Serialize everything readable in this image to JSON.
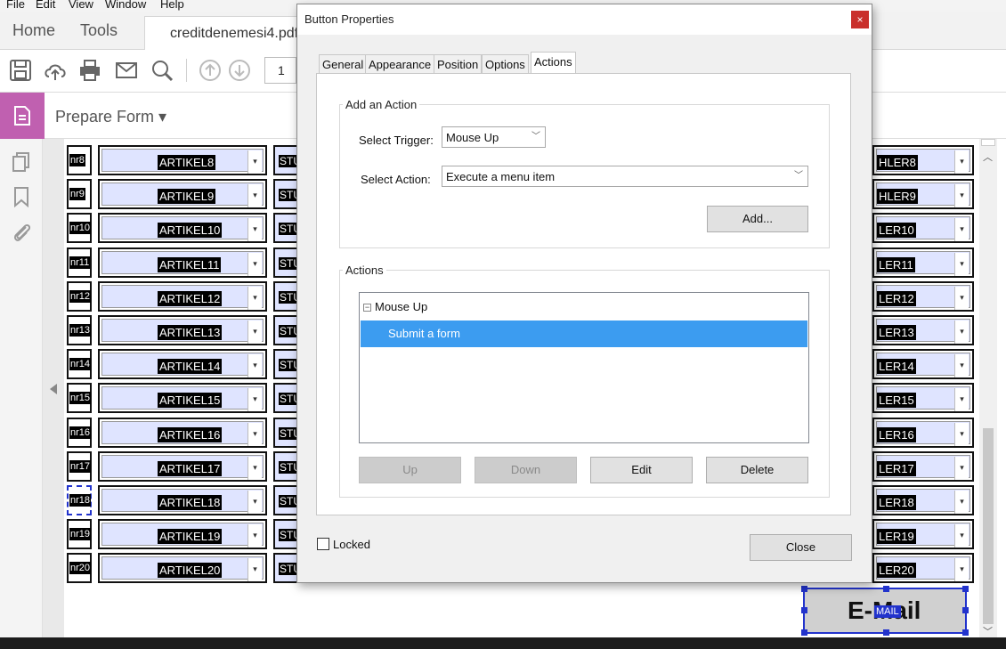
{
  "menu": {
    "file": "File",
    "edit": "Edit",
    "view": "View",
    "window": "Window",
    "help": "Help"
  },
  "tabs": {
    "home": "Home",
    "tools": "Tools",
    "document": "creditdenemesi4.pdf"
  },
  "toolbar": {
    "page_number": "1"
  },
  "prepare_form": {
    "label": "Prepare Form ▾"
  },
  "rows": [
    {
      "nr": "nr8",
      "artikel": "ARTIKEL8",
      "stu": "STU",
      "right": "HLER8"
    },
    {
      "nr": "nr9",
      "artikel": "ARTIKEL9",
      "stu": "STU",
      "right": "HLER9"
    },
    {
      "nr": "nr10",
      "artikel": "ARTIKEL10",
      "stu": "STU",
      "right": "LER10"
    },
    {
      "nr": "nr11",
      "artikel": "ARTIKEL11",
      "stu": "STU",
      "right": "LER11"
    },
    {
      "nr": "nr12",
      "artikel": "ARTIKEL12",
      "stu": "STU",
      "right": "LER12"
    },
    {
      "nr": "nr13",
      "artikel": "ARTIKEL13",
      "stu": "STU",
      "right": "LER13"
    },
    {
      "nr": "nr14",
      "artikel": "ARTIKEL14",
      "stu": "STU",
      "right": "LER14"
    },
    {
      "nr": "nr15",
      "artikel": "ARTIKEL15",
      "stu": "STU",
      "right": "LER15"
    },
    {
      "nr": "nr16",
      "artikel": "ARTIKEL16",
      "stu": "STU",
      "right": "LER16"
    },
    {
      "nr": "nr17",
      "artikel": "ARTIKEL17",
      "stu": "STU",
      "right": "LER17"
    },
    {
      "nr": "nr18",
      "artikel": "ARTIKEL18",
      "stu": "STU",
      "right": "LER18"
    },
    {
      "nr": "nr19",
      "artikel": "ARTIKEL19",
      "stu": "STU",
      "right": "LER19"
    },
    {
      "nr": "nr20",
      "artikel": "ARTIKEL20",
      "stu": "STU",
      "right": "LER20"
    }
  ],
  "email_button": {
    "label": "E-Mail",
    "field_name": "MAIL"
  },
  "dialog": {
    "title": "Button Properties",
    "close_icon": "×",
    "tabs": [
      "General",
      "Appearance",
      "Position",
      "Options",
      "Actions"
    ],
    "add_action": {
      "group_label": "Add an Action",
      "trigger_label": "Select Trigger:",
      "trigger_value": "Mouse Up",
      "action_label": "Select Action:",
      "action_value": "Execute a menu item",
      "add_button": "Add..."
    },
    "actions": {
      "group_label": "Actions",
      "tree_node": "Mouse Up",
      "selected_item": "Submit a form",
      "buttons": {
        "up": "Up",
        "down": "Down",
        "edit": "Edit",
        "delete": "Delete"
      }
    },
    "locked_label": "Locked",
    "close_button": "Close"
  },
  "colors": {
    "accent": "#c060b0",
    "selection": "#3c9cf0",
    "close_red": "#c9302c",
    "field_fill": "#dfe4ff"
  }
}
